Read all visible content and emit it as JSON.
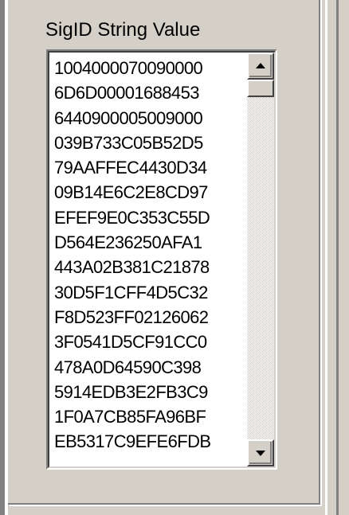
{
  "group": {
    "label": "SigID String Value"
  },
  "list": {
    "items": [
      "1004000070090000",
      "6D6D00001688453",
      "6440900005009000",
      "039B733C05B52D5",
      "79AAFFEC4430D34",
      "09B14E6C2E8CD97",
      "EFEF9E0C353C55D",
      "D564E236250AFA1",
      "443A02B381C21878",
      "30D5F1CFF4D5C32",
      "F8D523FF02126062",
      "3F0541D5CF91CC0",
      "478A0D64590C398",
      "5914EDB3E2FB3C9",
      "1F0A7CB85FA96BF",
      "EB5317C9EFE6FDB"
    ]
  },
  "scrollbar": {
    "up_icon": "triangle-up",
    "down_icon": "triangle-down"
  },
  "colors": {
    "window_bg": "#d4d0c8",
    "list_bg": "#ffffff",
    "text": "#000000"
  }
}
